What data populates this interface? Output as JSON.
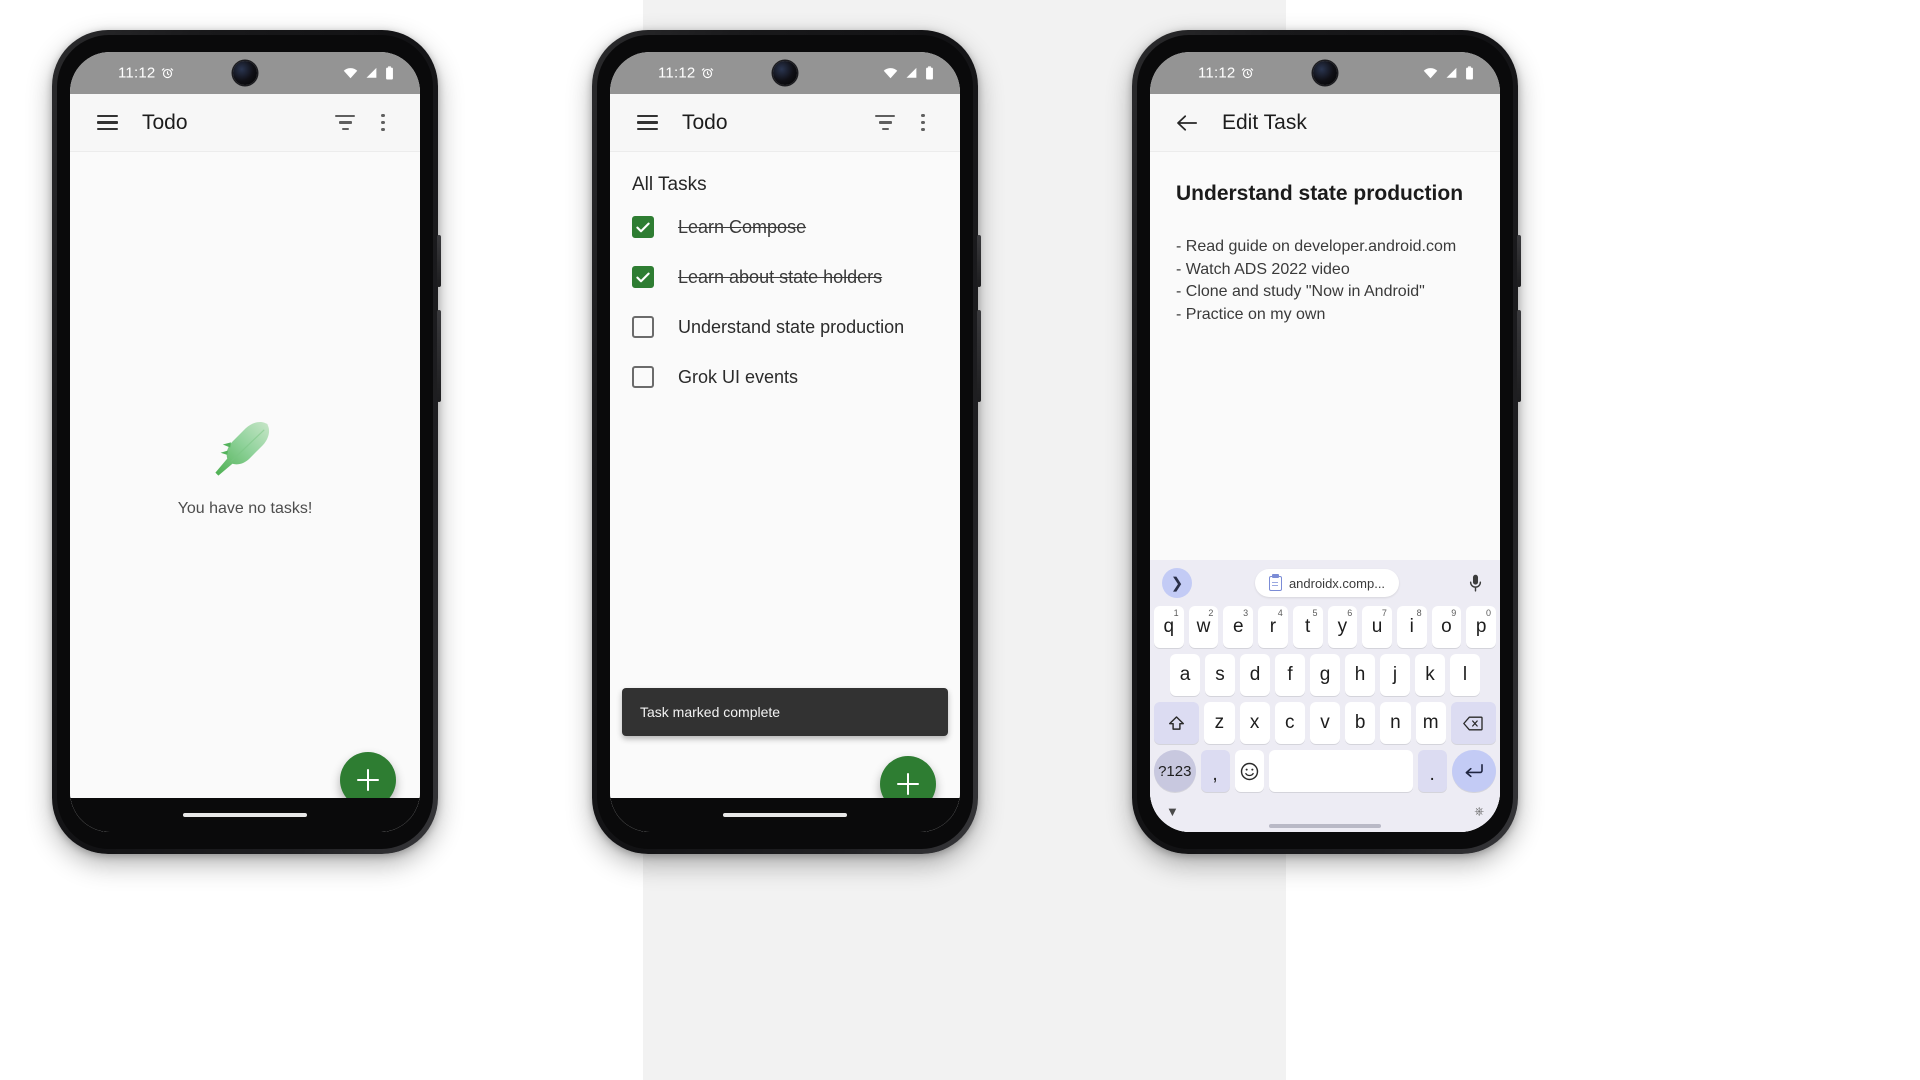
{
  "app": {
    "name": "Todo"
  },
  "phones": [
    {
      "id": "phone-empty",
      "statusbar": {
        "time": "11:12",
        "icons": [
          "alarm-icon",
          "wifi-icon",
          "signal-icon",
          "battery-icon"
        ]
      },
      "appbar": {
        "menu_icon": "hamburger-icon",
        "title": "Todo",
        "filter_icon": "filter-icon",
        "overflow_icon": "more-vert-icon"
      },
      "empty_state": {
        "illustration": "feather-icon",
        "message": "You have no tasks!"
      },
      "fab": {
        "icon": "plus-icon",
        "label": "+"
      }
    },
    {
      "id": "phone-list",
      "statusbar": {
        "time": "11:12",
        "icons": [
          "alarm-icon",
          "wifi-icon",
          "signal-icon",
          "battery-icon"
        ]
      },
      "appbar": {
        "menu_icon": "hamburger-icon",
        "title": "Todo",
        "filter_icon": "filter-icon",
        "overflow_icon": "more-vert-icon"
      },
      "list": {
        "section_title": "All Tasks",
        "tasks": [
          {
            "label": "Learn Compose",
            "done": true
          },
          {
            "label": "Learn about state holders",
            "done": true
          },
          {
            "label": "Understand state production",
            "done": false
          },
          {
            "label": "Grok UI events",
            "done": false
          }
        ]
      },
      "snackbar": {
        "message": "Task marked complete"
      },
      "fab": {
        "icon": "plus-icon",
        "label": "+"
      }
    },
    {
      "id": "phone-edit",
      "statusbar": {
        "time": "11:12",
        "icons": [
          "alarm-icon",
          "wifi-icon",
          "signal-icon",
          "battery-icon"
        ]
      },
      "appbar": {
        "back_icon": "arrow-left-icon",
        "title": "Edit Task"
      },
      "detail": {
        "title": "Understand state production",
        "body": "- Read guide on developer.android.com\n- Watch ADS 2022 video\n- Clone and study \"Now in Android\"\n- Practice on my own"
      },
      "fab": {
        "icon": "check-icon"
      },
      "keyboard": {
        "suggestion": {
          "chip_icon": "clipboard-icon",
          "chip_text": "androidx.comp...",
          "expand_icon": "chevron-right-icon",
          "mic_icon": "microphone-icon"
        },
        "row1": [
          {
            "key": "q",
            "num": "1"
          },
          {
            "key": "w",
            "num": "2"
          },
          {
            "key": "e",
            "num": "3"
          },
          {
            "key": "r",
            "num": "4"
          },
          {
            "key": "t",
            "num": "5"
          },
          {
            "key": "y",
            "num": "6"
          },
          {
            "key": "u",
            "num": "7"
          },
          {
            "key": "i",
            "num": "8"
          },
          {
            "key": "o",
            "num": "9"
          },
          {
            "key": "p",
            "num": "0"
          }
        ],
        "row2": [
          {
            "key": "a"
          },
          {
            "key": "s"
          },
          {
            "key": "d"
          },
          {
            "key": "f"
          },
          {
            "key": "g"
          },
          {
            "key": "h"
          },
          {
            "key": "j"
          },
          {
            "key": "k"
          },
          {
            "key": "l"
          }
        ],
        "row3": [
          {
            "key": "z"
          },
          {
            "key": "x"
          },
          {
            "key": "c"
          },
          {
            "key": "v"
          },
          {
            "key": "b"
          },
          {
            "key": "n"
          },
          {
            "key": "m"
          }
        ],
        "shift_icon": "shift-icon",
        "backspace_icon": "backspace-icon",
        "row4": {
          "symbols_label": "?123",
          "comma": ",",
          "emoji_icon": "emoji-icon",
          "space": "",
          "period": ".",
          "enter_icon": "enter-icon"
        },
        "footer": {
          "hide_icon": "chevron-down-icon",
          "switch_icon": "keyboard-icon"
        }
      }
    }
  ],
  "colors": {
    "accent_green": "#2e7d32",
    "statusbar_gray": "#949494",
    "appbar_bg": "#f7f7f7",
    "snackbar_bg": "#323232",
    "keyboard_bg": "#edecf4",
    "key_accent": "#c3cbf5"
  }
}
